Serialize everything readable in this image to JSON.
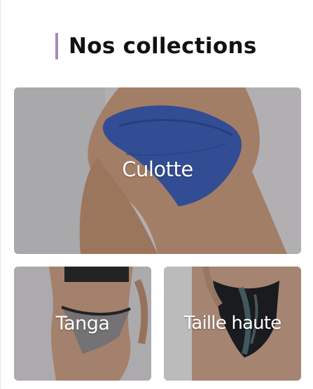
{
  "section": {
    "title": "Nos collections",
    "accent_color": "#a98aba"
  },
  "collections": [
    {
      "label": "Culotte",
      "image": "blue-briefs-photo"
    },
    {
      "label": "Tanga",
      "image": "grey-thong-photo"
    },
    {
      "label": "Taille haute",
      "image": "high-waist-lace-photo"
    }
  ]
}
